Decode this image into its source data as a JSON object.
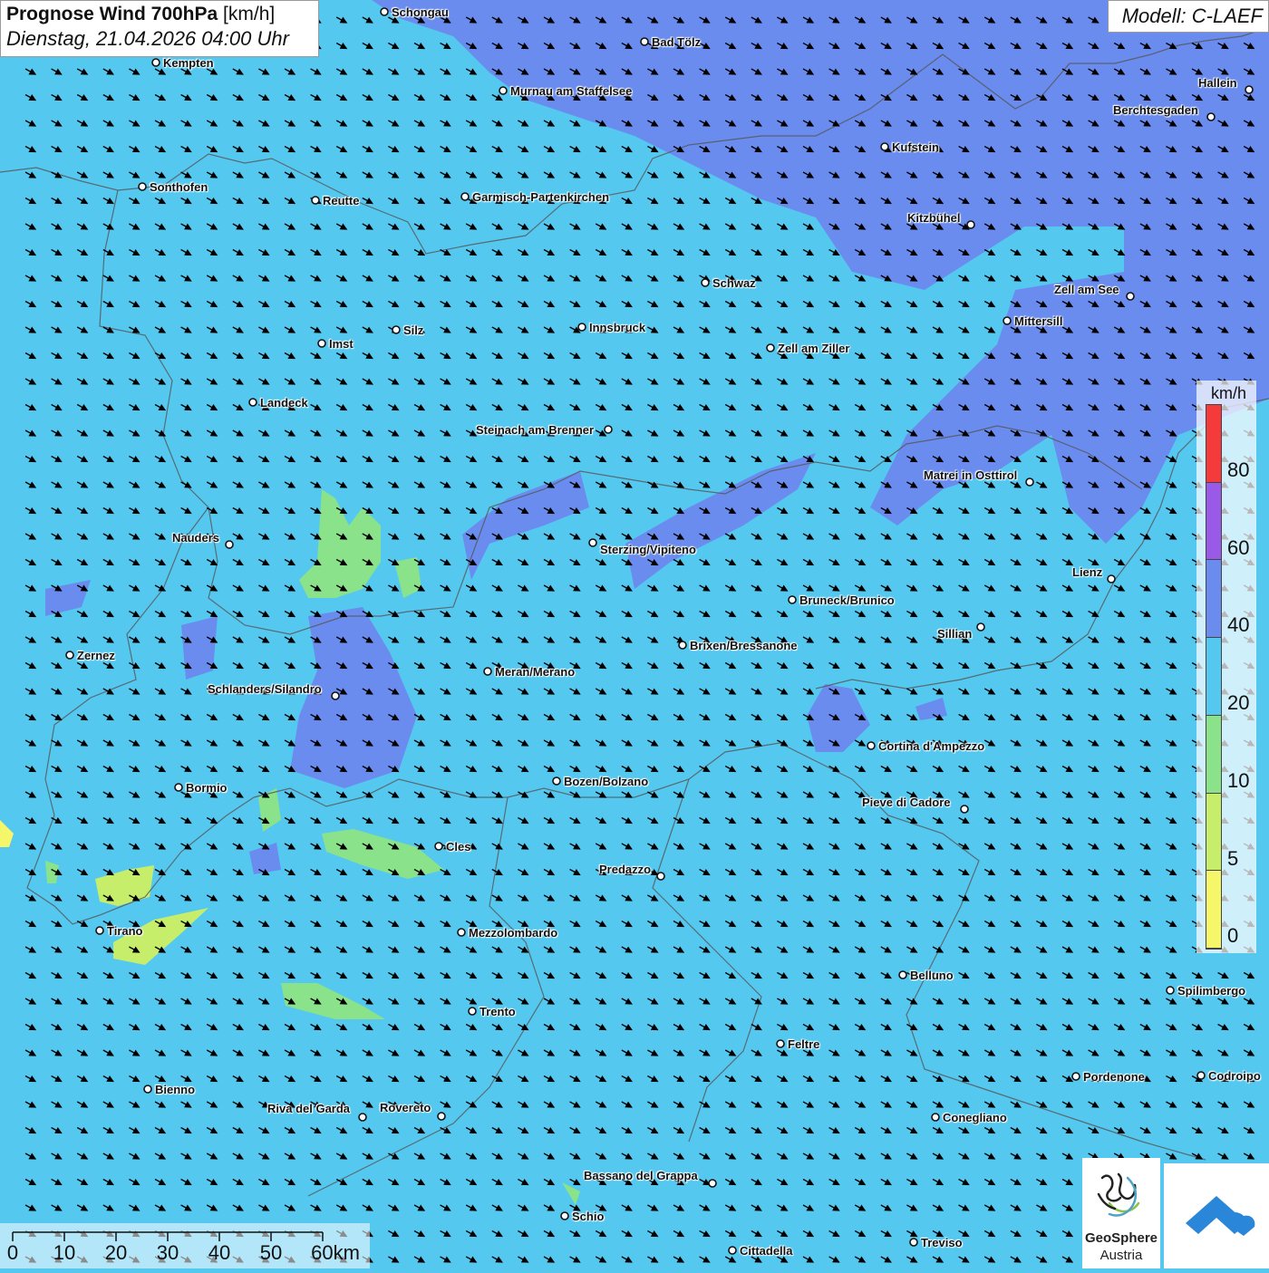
{
  "title": {
    "main": "Prognose Wind 700hPa",
    "unit": "[km/h]",
    "datetime": "Dienstag, 21.04.2026 04:00 Uhr"
  },
  "model": "Modell: C-LAEF",
  "colors": {
    "background": "#55c8f0",
    "band_20_40": "#55c8f0",
    "band_40_60": "#6a8cee",
    "band_10_20": "#8ae28a",
    "band_5_10": "#c6ee6a",
    "band_0_5": "#f6f66a",
    "band_60_80": "#9a5ae8",
    "band_80": "#f43a3a"
  },
  "cities": [
    {
      "name": "Schongau"
    },
    {
      "name": "Bad Tölz"
    },
    {
      "name": "Kempten"
    },
    {
      "name": "Murnau am Staffelsee"
    },
    {
      "name": "Hallein"
    },
    {
      "name": "Berchtesgaden"
    },
    {
      "name": "Kufstein"
    },
    {
      "name": "Sonthofen"
    },
    {
      "name": "Reutte"
    },
    {
      "name": "Garmisch-Partenkirchen"
    },
    {
      "name": "Kitzbühel"
    },
    {
      "name": "Schwaz"
    },
    {
      "name": "Zell am See"
    },
    {
      "name": "Mittersill"
    },
    {
      "name": "Innsbruck"
    },
    {
      "name": "Silz"
    },
    {
      "name": "Imst"
    },
    {
      "name": "Zell am Ziller"
    },
    {
      "name": "Landeck"
    },
    {
      "name": "Steinach am Brenner"
    },
    {
      "name": "Matrei in Osttirol"
    },
    {
      "name": "Nauders"
    },
    {
      "name": "Sterzing/Vipiteno"
    },
    {
      "name": "Lienz"
    },
    {
      "name": "Bruneck/Brunico"
    },
    {
      "name": "Sillian"
    },
    {
      "name": "Zernez"
    },
    {
      "name": "Brixen/Bressanone"
    },
    {
      "name": "Meran/Merano"
    },
    {
      "name": "Schlanders/Silandro"
    },
    {
      "name": "Cortina d'Ampezzo"
    },
    {
      "name": "Bozen/Bolzano"
    },
    {
      "name": "Bormio"
    },
    {
      "name": "Pieve di Cadore"
    },
    {
      "name": "Cles"
    },
    {
      "name": "Predazzo"
    },
    {
      "name": "Tirano"
    },
    {
      "name": "Mezzolombardo"
    },
    {
      "name": "Belluno"
    },
    {
      "name": "Spilimbergo"
    },
    {
      "name": "Trento"
    },
    {
      "name": "Feltre"
    },
    {
      "name": "Bienno"
    },
    {
      "name": "Pordenone"
    },
    {
      "name": "Codroipo"
    },
    {
      "name": "Riva del Garda"
    },
    {
      "name": "Rovereto"
    },
    {
      "name": "Conegliano"
    },
    {
      "name": "Bassano del Grappa"
    },
    {
      "name": "Schio"
    },
    {
      "name": "Treviso"
    },
    {
      "name": "Cittadella"
    }
  ],
  "legend": {
    "unit": "km/h",
    "labels": [
      "80",
      "60",
      "40",
      "20",
      "10",
      "5",
      "0"
    ],
    "colors": [
      "#f43a3a",
      "#9a5ae8",
      "#6a8cee",
      "#55c8f0",
      "#8ae28a",
      "#c6ee6a",
      "#f6f66a"
    ]
  },
  "scalebar": {
    "labels": [
      "0",
      "10",
      "20",
      "30",
      "40",
      "50",
      "60km"
    ]
  },
  "logos": {
    "geosphere_line1": "GeoSphere",
    "geosphere_line2": "Austria"
  }
}
